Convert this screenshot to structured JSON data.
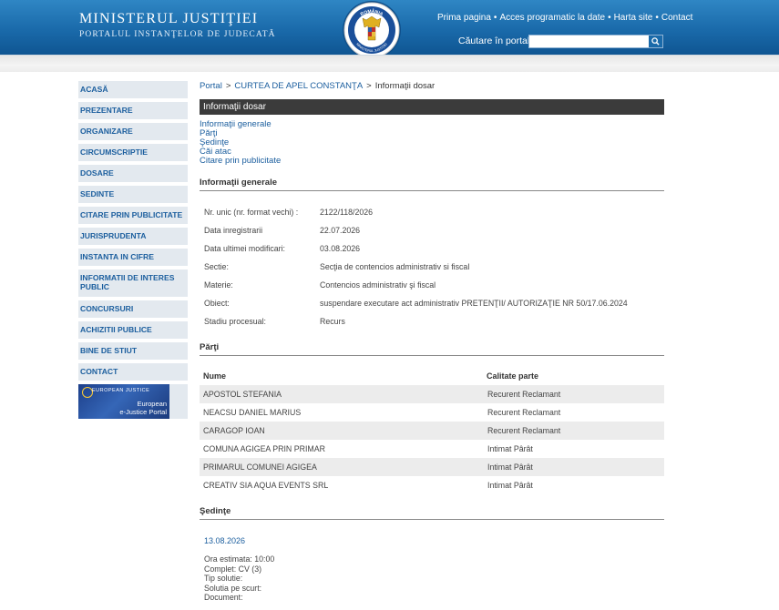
{
  "header": {
    "title": "MINISTERUL JUSTIŢIEI",
    "subtitle": "PORTALUL INSTANŢELOR DE JUDECATĂ",
    "emblem_top": "ROMÂNIA",
    "emblem_bottom": "MINISTERUL JUSTIŢIEI",
    "nav": [
      "Prima pagina",
      "Acces programatic la date",
      "Harta site",
      "Contact"
    ],
    "search_label": "Căutare în portal",
    "search_placeholder": ""
  },
  "sidebar": {
    "items": [
      "ACASĂ",
      "PREZENTARE",
      "ORGANIZARE",
      "CIRCUMSCRIPTIE",
      "DOSARE",
      "SEDINTE",
      "CITARE PRIN PUBLICITATE",
      "JURISPRUDENTA",
      "INSTANTA IN CIFRE",
      "INFORMATII DE INTERES PUBLIC",
      "CONCURSURI",
      "ACHIZITII PUBLICE",
      "BINE DE STIUT",
      "CONTACT"
    ],
    "ejustice": {
      "top": "EUROPEAN JUSTICE",
      "bottom_line1": "European",
      "bottom_line2": "e-Justice Portal"
    }
  },
  "breadcrumb": {
    "portal": "Portal",
    "court": "CURTEA DE APEL CONSTANŢA",
    "current": "Informaţii dosar",
    "sep": ">"
  },
  "page_title": "Informaţii dosar",
  "anchors": [
    "Informaţii generale",
    "Părţi",
    "Şedinţe",
    "Căi atac",
    "Citare prin publicitate"
  ],
  "info": {
    "heading": "Informaţii generale",
    "rows": [
      {
        "label": "Nr. unic (nr. format vechi) :",
        "value": "2122/118/2026"
      },
      {
        "label": "Data inregistrarii",
        "value": "22.07.2026"
      },
      {
        "label": "Data ultimei modificari:",
        "value": "03.08.2026"
      },
      {
        "label": "Sectie:",
        "value": "Secţia de contencios administrativ si fiscal"
      },
      {
        "label": "Materie:",
        "value": "Contencios administrativ şi fiscal"
      },
      {
        "label": "Obiect:",
        "value": "suspendare executare act administrativ PRETENŢII/ AUTORIZAŢIE NR 50/17.06.2024"
      },
      {
        "label": "Stadiu procesual:",
        "value": "Recurs"
      }
    ]
  },
  "parti": {
    "heading": "Părţi",
    "col_name": "Nume",
    "col_role": "Calitate parte",
    "rows": [
      {
        "name": "APOSTOL STEFANIA",
        "role": "Recurent Reclamant"
      },
      {
        "name": "NEACSU DANIEL MARIUS",
        "role": "Recurent Reclamant"
      },
      {
        "name": "CARAGOP IOAN",
        "role": "Recurent Reclamant"
      },
      {
        "name": "COMUNA AGIGEA PRIN PRIMAR",
        "role": "Intimat Pârât"
      },
      {
        "name": "PRIMARUL COMUNEI AGIGEA",
        "role": "Intimat Pârât"
      },
      {
        "name": "CREATIV SIA AQUA EVENTS SRL",
        "role": "Intimat Pârât"
      }
    ]
  },
  "sedinte": {
    "heading": "Şedinţe",
    "date": "13.08.2026",
    "details": [
      "Ora estimata: 10:00",
      "Complet: CV (3)",
      "Tip solutie:",
      "Solutia pe scurt:",
      "Document:"
    ]
  },
  "colors": {
    "header_blue": "#1a6aaa",
    "link_blue": "#1b5e9e",
    "sidebar_bg": "#e3e9ef",
    "title_bar": "#3b3b3b",
    "row_alt": "#ececec"
  },
  "icons": {
    "search_button": "magnifier-icon",
    "emblem": "coat-of-arms-icon",
    "ejustice": "ejustice-logo"
  }
}
